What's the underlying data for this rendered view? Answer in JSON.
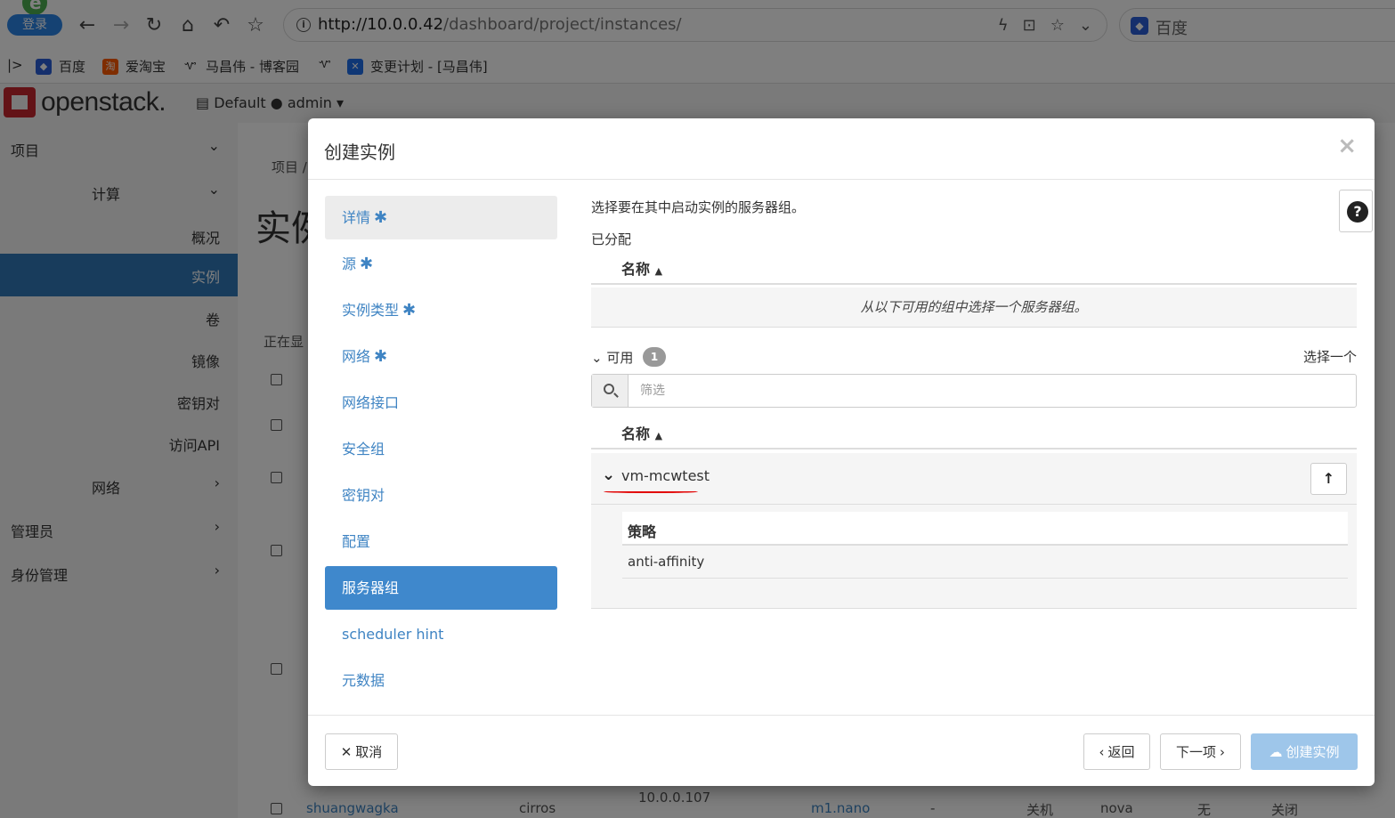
{
  "browser": {
    "login_badge": "登录",
    "url_host": "http://10.0.0.42",
    "url_path": "/dashboard/project/instances/",
    "search_engine": "百度",
    "bookmarks": [
      "百度",
      "爱淘宝",
      "马昌伟 - 博客园",
      "变更计划 - [马昌伟]"
    ]
  },
  "app": {
    "logo": "openstack.",
    "domain": "Default",
    "user": "admin"
  },
  "sidebar": {
    "project": "项目",
    "compute": "计算",
    "overview": "概况",
    "instances": "实例",
    "volumes": "卷",
    "images": "镜像",
    "keypairs": "密钥对",
    "api_access": "访问API",
    "network": "网络",
    "admin": "管理员",
    "identity": "身份管理"
  },
  "background": {
    "breadcrumb": "项目 /",
    "page_title": "实例",
    "showing": "正在显",
    "row_name": "shuangwagka",
    "row_image": "cirros",
    "row_ip": "10.0.0.107",
    "row_flavor": "m1.nano",
    "row_dash": "-",
    "row_status": "关机",
    "row_zone": "nova",
    "row_task": "无",
    "row_power": "关闭"
  },
  "modal": {
    "title": "创建实例",
    "close": "×",
    "steps": [
      {
        "label": "详情",
        "required": true
      },
      {
        "label": "源",
        "required": true
      },
      {
        "label": "实例类型",
        "required": true
      },
      {
        "label": "网络",
        "required": true
      },
      {
        "label": "网络接口",
        "required": false
      },
      {
        "label": "安全组",
        "required": false
      },
      {
        "label": "密钥对",
        "required": false
      },
      {
        "label": "配置",
        "required": false
      },
      {
        "label": "服务器组",
        "required": false
      },
      {
        "label": "scheduler hint",
        "required": false
      },
      {
        "label": "元数据",
        "required": false
      }
    ],
    "required_mark": "✱",
    "description": "选择要在其中启动实例的服务器组。",
    "allocated_label": "已分配",
    "name_col": "名称",
    "sort_icon": "▲",
    "empty_msg": "从以下可用的组中选择一个服务器组。",
    "available_label": "可用",
    "available_count": "1",
    "select_one": "选择一个",
    "filter_placeholder": "筛选",
    "group_name": "vm-mcwtest",
    "policy_header": "策略",
    "policy_value": "anti-affinity",
    "cancel": "取消",
    "back": "返回",
    "next": "下一项",
    "create": "创建实例"
  }
}
